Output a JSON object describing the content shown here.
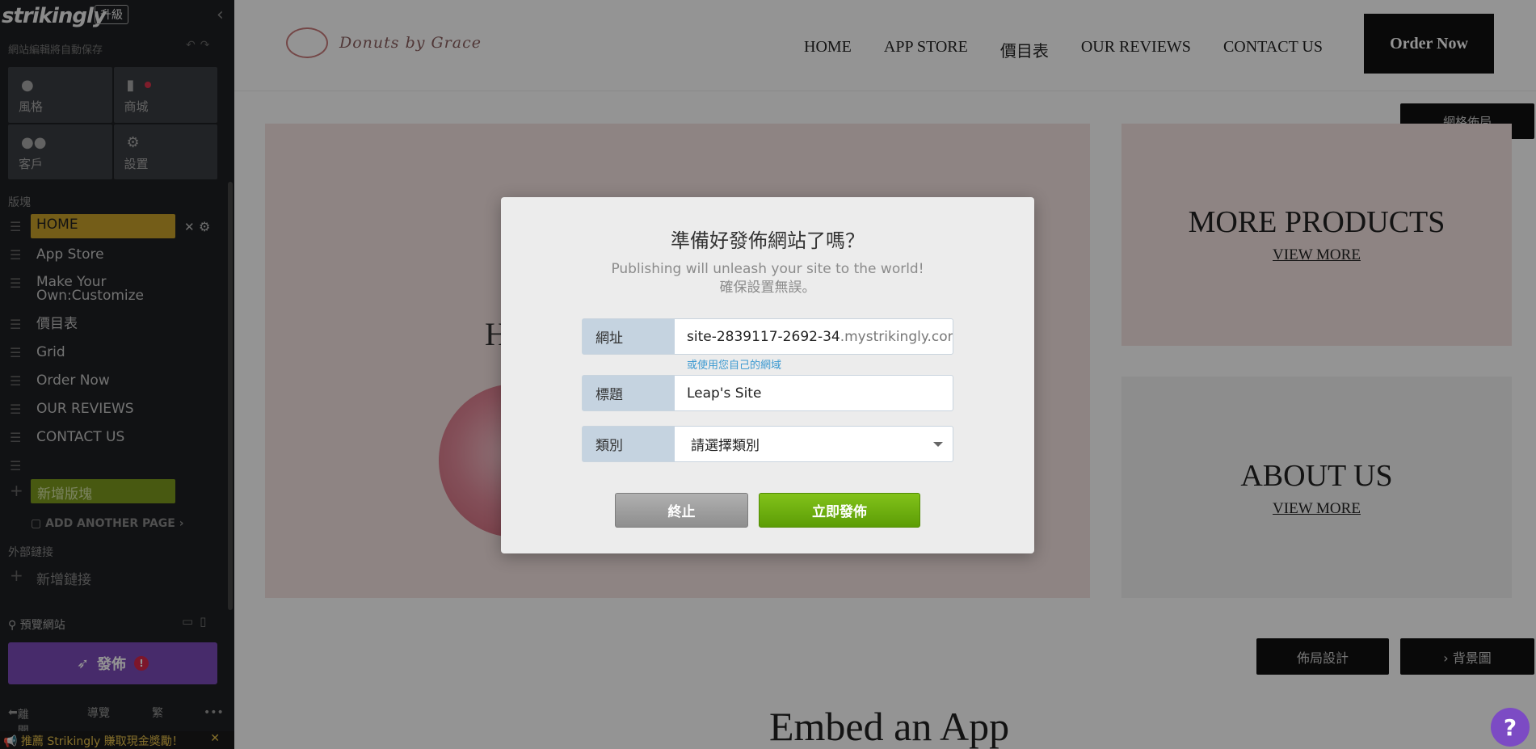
{
  "sidebar": {
    "logo": "strikingly",
    "upgrade": "升級",
    "autosave": "網站編輯將自動保存",
    "tiles": [
      {
        "label": "風格",
        "icon": "palette-icon"
      },
      {
        "label": "商城",
        "icon": "shopping-bag-icon"
      },
      {
        "label": "客戶",
        "icon": "users-icon"
      },
      {
        "label": "設置",
        "icon": "gear-icon"
      }
    ],
    "blocks_label": "版塊",
    "nav_items": [
      {
        "label": "HOME"
      },
      {
        "label": "App Store"
      },
      {
        "label": "Make Your Own:Customize"
      },
      {
        "label": "價目表"
      },
      {
        "label": "Grid"
      },
      {
        "label": "Order Now"
      },
      {
        "label": "OUR REVIEWS"
      },
      {
        "label": "CONTACT US"
      }
    ],
    "add_block": "新增版塊",
    "add_page": "ADD ANOTHER PAGE",
    "external_label": "外部鏈接",
    "add_link": "新增鏈接",
    "preview": "預覽網站",
    "publish": "發佈",
    "bottom": {
      "exit": "離開",
      "guide": "導覽",
      "lang": "繁",
      "more": "•••"
    },
    "promo": "推薦 Strikingly 賺取現金獎勵！"
  },
  "site": {
    "logo_text": "Donuts by Grace",
    "nav": [
      "HOME",
      "APP STORE",
      "價目表",
      "OUR REVIEWS",
      "CONTACT US"
    ],
    "order_now": "Order Now",
    "grid_layout": "網格佈局",
    "hero_heading_fragment": "H",
    "more_products": "MORE PRODUCTS",
    "about_us": "ABOUT US",
    "view_more": "VIEW MORE",
    "layout_design": "佈局設計",
    "background": "› 背景圖",
    "embed_title": "Embed an App",
    "help": "?"
  },
  "modal": {
    "title": "準備好發佈網站了嗎？",
    "subtitle_line1": "Publishing will unleash your site to the world!",
    "subtitle_line2": "確保設置無誤。",
    "url_label": "網址",
    "url_value": "site-2839117-2692-34",
    "url_suffix": ".mystrikingly.com",
    "own_domain": "或使用您自己的網域",
    "title_label": "標題",
    "title_value": "Leap's Site",
    "category_label": "類別",
    "category_value": "請選擇類別",
    "cancel": "終止",
    "publish_now": "立即發佈"
  },
  "colors": {
    "sidebar_bg": "#1e2023",
    "home_highlight": "#c9a02a",
    "add_block": "#7c9a1e",
    "publish_purple": "#7a4bb8",
    "modal_publish_green": "#6aaa0f"
  }
}
